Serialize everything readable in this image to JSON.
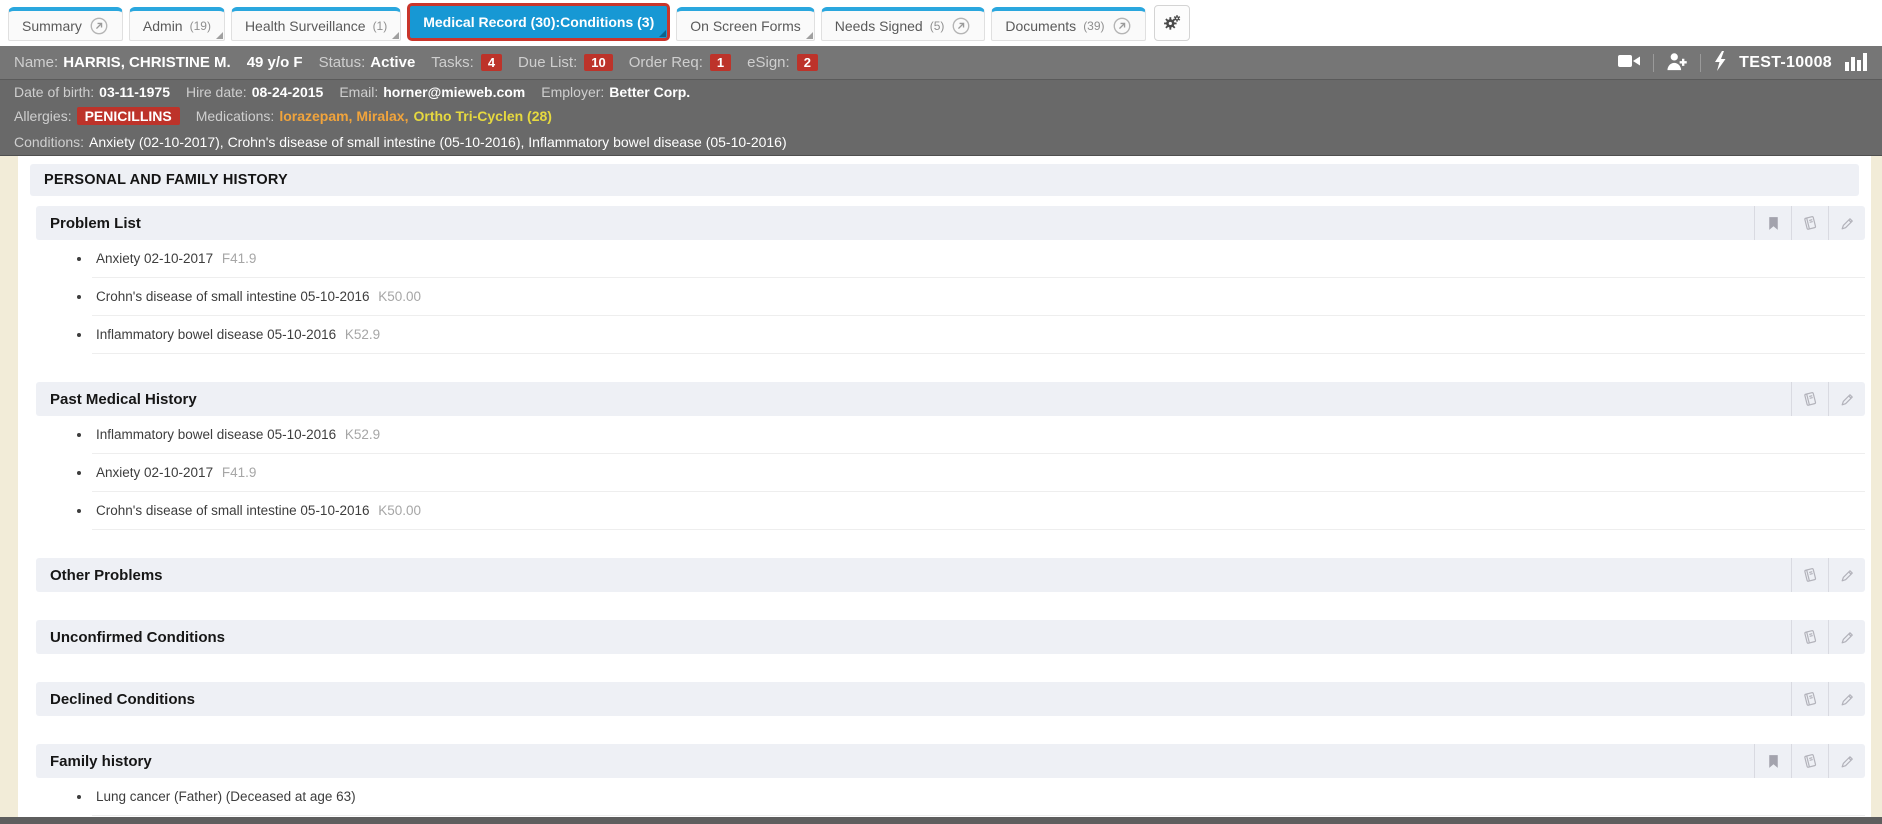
{
  "tabs": [
    {
      "label": "Summary"
    },
    {
      "label": "Admin",
      "count": "(19)"
    },
    {
      "label": "Health Surveillance",
      "count": "(1)"
    },
    {
      "label": "Medical Record (30):Conditions (3)"
    },
    {
      "label": "On Screen Forms"
    },
    {
      "label": "Needs Signed",
      "count": "(5)"
    },
    {
      "label": "Documents",
      "count": "(39)"
    }
  ],
  "patient": {
    "name_label": "Name:",
    "name": "HARRIS, CHRISTINE M.",
    "age_sex": "49 y/o F",
    "status_label": "Status:",
    "status": "Active",
    "tasks_label": "Tasks:",
    "tasks": "4",
    "due_label": "Due List:",
    "due": "10",
    "order_label": "Order Req:",
    "order": "1",
    "esign_label": "eSign:",
    "esign": "2",
    "employee_id": "TEST-10008",
    "dob_label": "Date of birth:",
    "dob": "03-11-1975",
    "hire_label": "Hire date:",
    "hire": "08-24-2015",
    "email_label": "Email:",
    "email": "horner@mieweb.com",
    "employer_label": "Employer:",
    "employer": "Better Corp.",
    "allergies_label": "Allergies:",
    "allergy": "PENICILLINS",
    "medications_label": "Medications:",
    "medications_orange": "lorazepam, Miralax,",
    "medications_yellow": "Ortho Tri-Cyclen (28)",
    "conditions_label": "Conditions:",
    "conditions": "Anxiety (02-10-2017), Crohn's disease of small intestine (05-10-2016), Inflammatory bowel disease (05-10-2016)"
  },
  "page_title": "PERSONAL AND FAMILY HISTORY",
  "sections": [
    {
      "title": "Problem List",
      "icons": [
        "bookmark-icon",
        "book-icon",
        "pencil-icon"
      ],
      "items": [
        {
          "text": "Anxiety 02-10-2017",
          "code": "F41.9"
        },
        {
          "text": "Crohn's disease of small intestine 05-10-2016",
          "code": "K50.00"
        },
        {
          "text": "Inflammatory bowel disease 05-10-2016",
          "code": "K52.9"
        }
      ]
    },
    {
      "title": "Past Medical History",
      "icons": [
        "book-icon",
        "pencil-icon"
      ],
      "items": [
        {
          "text": "Inflammatory bowel disease 05-10-2016",
          "code": "K52.9"
        },
        {
          "text": "Anxiety 02-10-2017",
          "code": "F41.9"
        },
        {
          "text": "Crohn's disease of small intestine 05-10-2016",
          "code": "K50.00"
        }
      ]
    },
    {
      "title": "Other Problems",
      "icons": [
        "book-icon",
        "pencil-icon"
      ],
      "items": []
    },
    {
      "title": "Unconfirmed Conditions",
      "icons": [
        "book-icon",
        "pencil-icon"
      ],
      "items": []
    },
    {
      "title": "Declined Conditions",
      "icons": [
        "book-icon",
        "pencil-icon"
      ],
      "items": []
    },
    {
      "title": "Family history",
      "icons": [
        "bookmark-icon",
        "book-icon",
        "pencil-icon"
      ],
      "items": [
        {
          "text": "Lung cancer (Father) (Deceased at age 63)",
          "code": ""
        }
      ]
    }
  ],
  "header_icons": [
    "video-camera-icon",
    "add-person-icon",
    "lightning-icon",
    "bar-chart-icon"
  ],
  "colors": {
    "tab_accent_blue": "#2aa7de",
    "active_tab_blue": "#1798d4",
    "active_tab_border_red": "#c9362c",
    "alert_badge_red": "#bd332a",
    "medication_orange": "#f1a43c",
    "medication_yellow": "#e6d93f",
    "header_gray": "#696969",
    "body_cream": "#f2ecd8",
    "section_header_bg": "#eef0f5"
  }
}
